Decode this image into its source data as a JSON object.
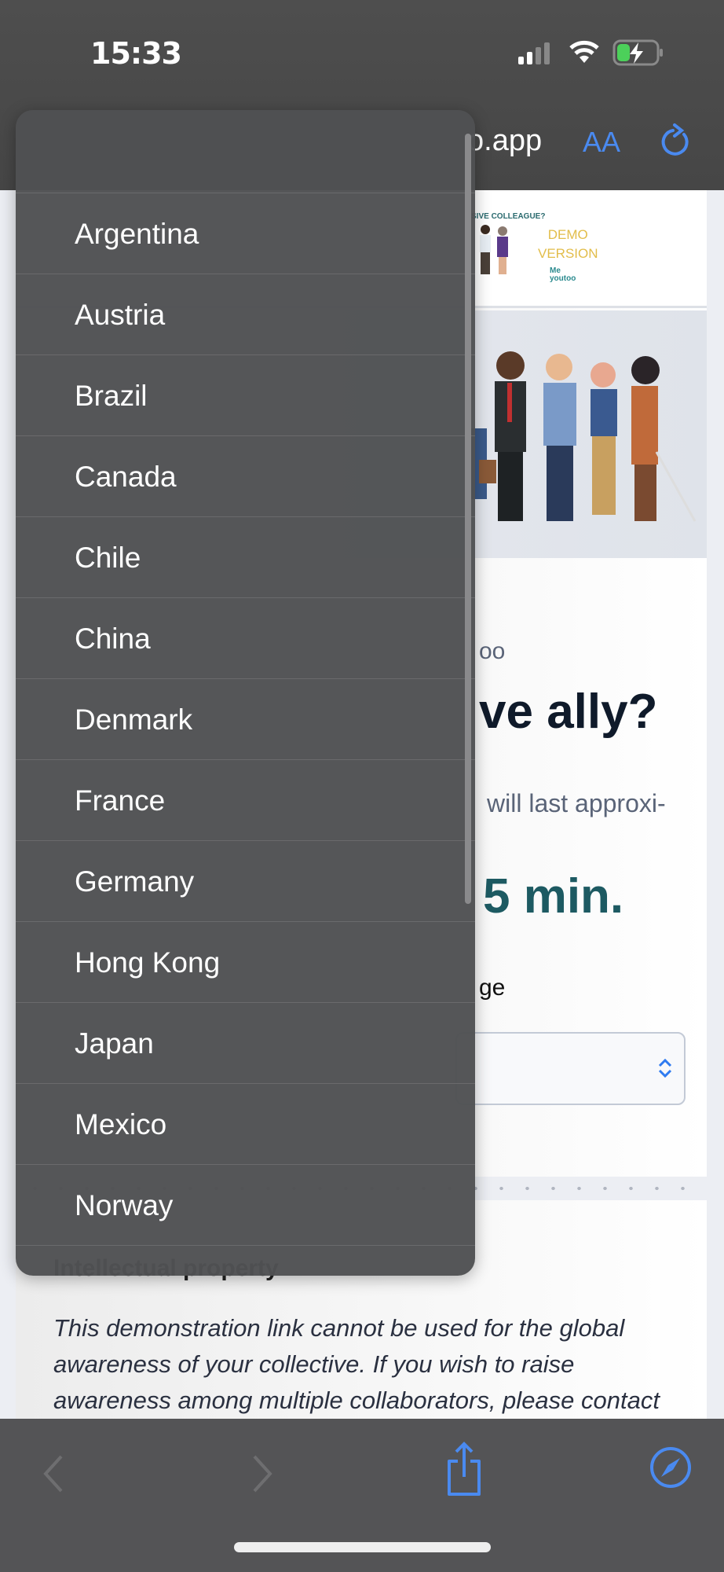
{
  "status_bar": {
    "time": "15:33",
    "battery_state": "charging"
  },
  "browser": {
    "url_fragment": "o.app",
    "text_size_label": "AA",
    "accent": "#4a8af0"
  },
  "page": {
    "banner": {
      "title_fragment": "SIVE COLLEAGUE?",
      "demo_line1": "DEMO",
      "demo_line2": "VERSION",
      "logo_line1": "Me",
      "logo_line2": "youtoo"
    },
    "brand_fragment": "oo",
    "heading_fragment": "ve ally?",
    "subtitle_fragment": "will last approxi-",
    "duration_fragment": "5 min.",
    "language_label_fragment": "ge",
    "ip_heading": "Intellectual property",
    "paragraph": "This demonstration link cannot be used for the global awareness of your collective. If you wish to raise awareness among multiple collaborators, please contact"
  },
  "dropdown": {
    "options": [
      "Argentina",
      "Austria",
      "Brazil",
      "Canada",
      "Chile",
      "China",
      "Denmark",
      "France",
      "Germany",
      "Hong Kong",
      "Japan",
      "Mexico",
      "Norway"
    ]
  },
  "toolbar": {
    "items": [
      "back",
      "forward",
      "share",
      "compass"
    ]
  }
}
